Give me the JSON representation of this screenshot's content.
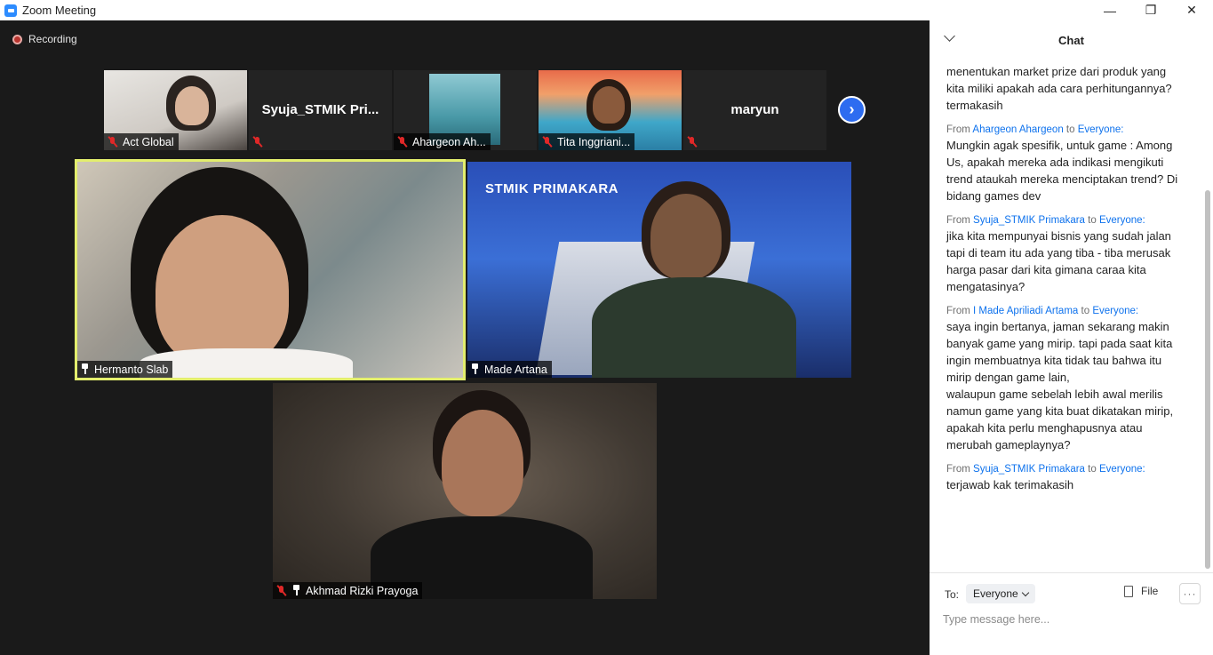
{
  "window": {
    "title": "Zoom Meeting",
    "minimize": "—",
    "restore": "❐",
    "close": "✕"
  },
  "meeting": {
    "recording_label": "Recording",
    "next_page": "›",
    "strip": [
      {
        "name": "Act Global",
        "type": "video"
      },
      {
        "name": "Syuja_STMIK_Pri...",
        "big_name": "Syuja_STMIK  Pri...",
        "type": "name"
      },
      {
        "name": "Ahargeon Ah...",
        "type": "video"
      },
      {
        "name": "Tita Inggriani...",
        "type": "video"
      },
      {
        "name": "",
        "big_name": "maryun",
        "type": "name"
      }
    ],
    "tiles": [
      {
        "name": "Hermanto Slab",
        "active_speaker": true
      },
      {
        "name": "Made Artana",
        "logo_text": "STMIK PRIMAKARA"
      },
      {
        "name": "Akhmad Rizki Prayoga"
      }
    ]
  },
  "chat": {
    "title": "Chat",
    "messages": [
      {
        "from": "",
        "to": "",
        "body": "menentukan market prize dari produk yang kita miliki apakah ada cara perhitungannya? termakasih"
      },
      {
        "from": "Ahargeon Ahargeon",
        "to": "Everyone:",
        "body": "Mungkin agak spesifik, untuk game : Among Us, apakah mereka ada indikasi mengikuti trend ataukah mereka menciptakan trend? Di bidang games dev"
      },
      {
        "from": "Syuja_STMIK Primakara",
        "to": "Everyone:",
        "body": "jika kita mempunyai bisnis yang sudah jalan tapi di team itu ada yang tiba - tiba merusak harga pasar dari kita gimana caraa kita mengatasinya?"
      },
      {
        "from": "I Made Apriliadi Artama",
        "to": "Everyone:",
        "body": "saya ingin bertanya, jaman sekarang makin banyak game yang mirip. tapi pada saat kita ingin membuatnya kita tidak tau bahwa itu mirip dengan game lain,\nwalaupun game sebelah lebih awal merilis namun game yang kita buat dikatakan mirip, apakah kita perlu menghapusnya atau merubah gameplaynya?"
      },
      {
        "from": "Syuja_STMIK Primakara",
        "to": "Everyone:",
        "body": "terjawab kak terimakasih"
      }
    ],
    "from_word": "From",
    "to_word": "to",
    "footer": {
      "to_label": "To:",
      "recipient": "Everyone",
      "file_label": "File",
      "more": "···",
      "input_placeholder": "Type message here..."
    }
  }
}
